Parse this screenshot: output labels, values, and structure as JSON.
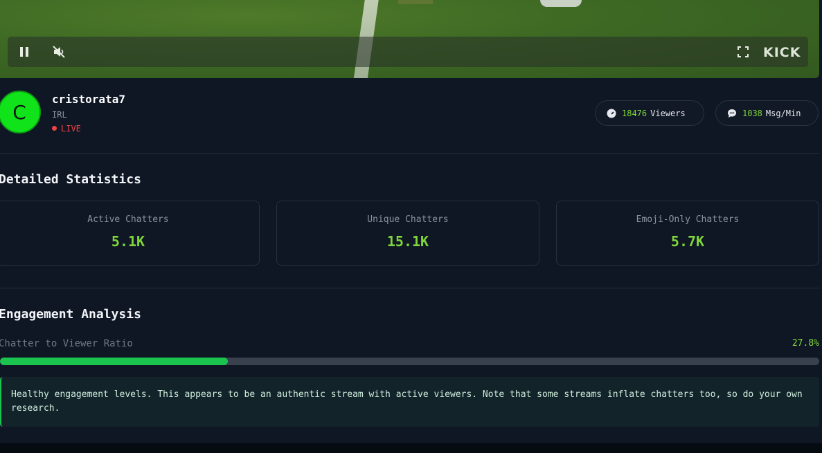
{
  "player": {
    "brand": "KICK",
    "controls": {
      "pause_icon": "pause-icon",
      "mute_icon": "muted-speaker-icon",
      "fullscreen_icon": "fullscreen-icon"
    }
  },
  "channel": {
    "avatar_letter": "C",
    "name": "cristorata7",
    "category": "IRL",
    "status": "LIVE"
  },
  "metrics": {
    "viewers_count": "18476",
    "viewers_label": "Viewers",
    "msg_count": "1038",
    "msg_label": "Msg/Min"
  },
  "detailed_statistics": {
    "title": "Detailed Statistics",
    "cards": [
      {
        "label": "Active Chatters",
        "value": "5.1K"
      },
      {
        "label": "Unique Chatters",
        "value": "15.1K"
      },
      {
        "label": "Emoji-Only Chatters",
        "value": "5.7K"
      }
    ]
  },
  "engagement": {
    "title": "Engagement Analysis",
    "ratio_label": "Chatter to Viewer Ratio",
    "ratio_value": "27.8%",
    "ratio_fraction": 0.278,
    "note": "Healthy engagement levels. This appears to be an authentic stream with active viewers. Note that some streams inflate chatters too, so do your own research."
  },
  "colors": {
    "accent_green": "#7fd63a",
    "bar_green": "#1bc44e",
    "live_red": "#ef4444",
    "background": "#0f1624"
  }
}
